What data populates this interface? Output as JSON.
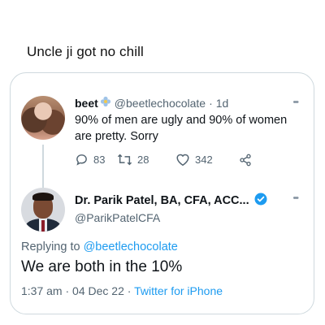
{
  "caption": "Uncle ji got no chill",
  "tweet1": {
    "name": "beet",
    "handle": "@beetlechocolate",
    "separator": "·",
    "time": "1d",
    "text": "90% of men are ugly and 90% of women are pretty. Sorry",
    "replies": "83",
    "retweets": "28",
    "likes": "342"
  },
  "tweet2": {
    "name": "Dr. Parik Patel, BA, CFA, ACC...",
    "handle": "@ParikPatelCFA",
    "replying_prefix": "Replying to",
    "replying_to": "@beetlechocolate",
    "text": "We are both in the 10%",
    "time": "1:37 am",
    "date": "04 Dec 22",
    "source": "Twitter for iPhone",
    "separator": "·"
  },
  "colors": {
    "accent": "#1d9bf0",
    "muted": "#536471",
    "border": "#cfd9de"
  }
}
